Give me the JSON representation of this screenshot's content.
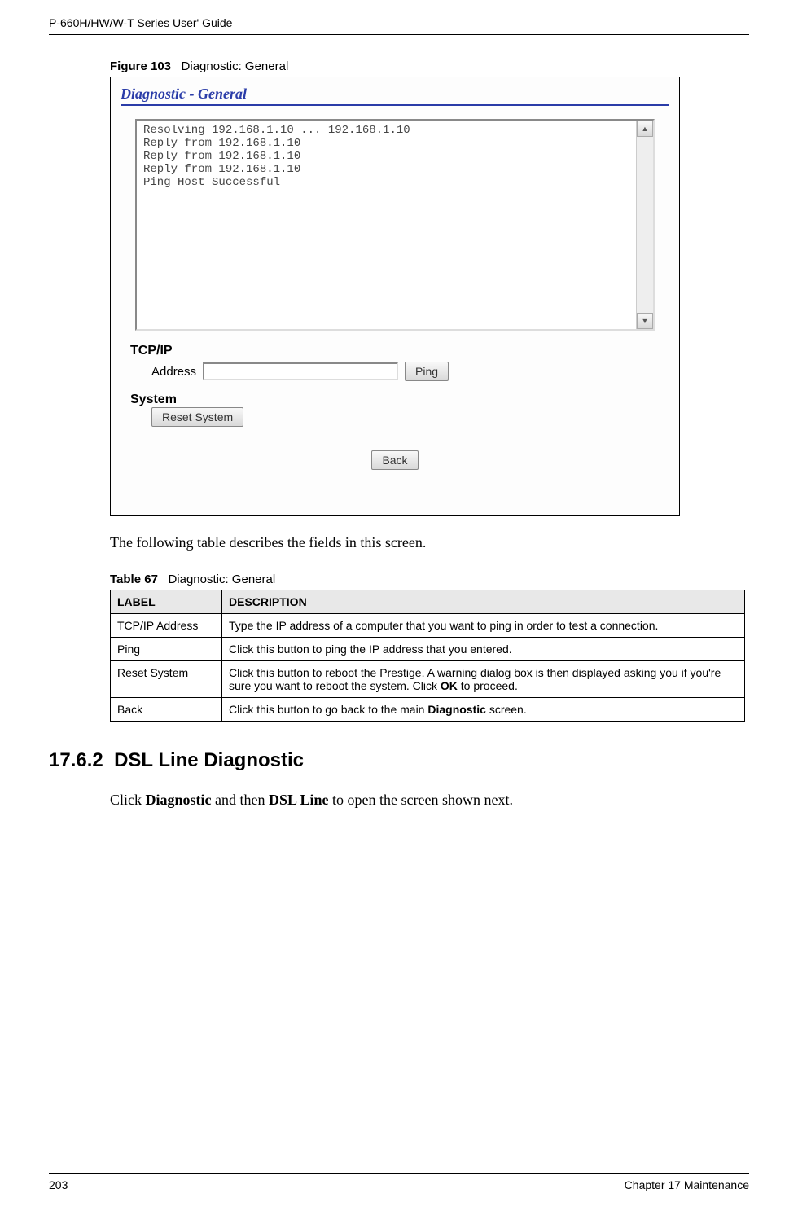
{
  "header": {
    "guide_title": "P-660H/HW/W-T Series User' Guide"
  },
  "figure": {
    "label": "Figure 103",
    "title": "Diagnostic: General"
  },
  "screenshot": {
    "panel_title": "Diagnostic - General",
    "console_output": "Resolving 192.168.1.10 ... 192.168.1.10\nReply from 192.168.1.10\nReply from 192.168.1.10\nReply from 192.168.1.10\nPing Host Successful",
    "tcpip_label": "TCP/IP",
    "address_label": "Address",
    "ping_button": "Ping",
    "system_label": "System",
    "reset_button": "Reset System",
    "back_button": "Back"
  },
  "post_figure_text": "The following table describes the fields in this screen.",
  "table": {
    "caption_label": "Table 67",
    "caption_title": "Diagnostic: General",
    "header_label": "LABEL",
    "header_desc": "DESCRIPTION",
    "rows": [
      {
        "label": "TCP/IP Address",
        "desc": "Type the IP address of a computer that you want to ping in order to test a connection."
      },
      {
        "label": "Ping",
        "desc": "Click this button to ping the IP address that you entered."
      },
      {
        "label": "Reset System",
        "desc_prefix": "Click this button to reboot the Prestige. A warning dialog box is then displayed asking you if you're sure you want to reboot the system. Click ",
        "desc_bold": "OK",
        "desc_suffix": " to proceed."
      },
      {
        "label": "Back",
        "desc_prefix": "Click this button to go back to the main ",
        "desc_bold": "Diagnostic",
        "desc_suffix": " screen."
      }
    ]
  },
  "section": {
    "number": "17.6.2",
    "title": "DSL Line Diagnostic",
    "body_prefix": "Click ",
    "body_bold1": "Diagnostic",
    "body_mid": " and then ",
    "body_bold2": "DSL Line",
    "body_suffix": " to open the screen shown next."
  },
  "footer": {
    "page": "203",
    "chapter": "Chapter 17 Maintenance"
  }
}
